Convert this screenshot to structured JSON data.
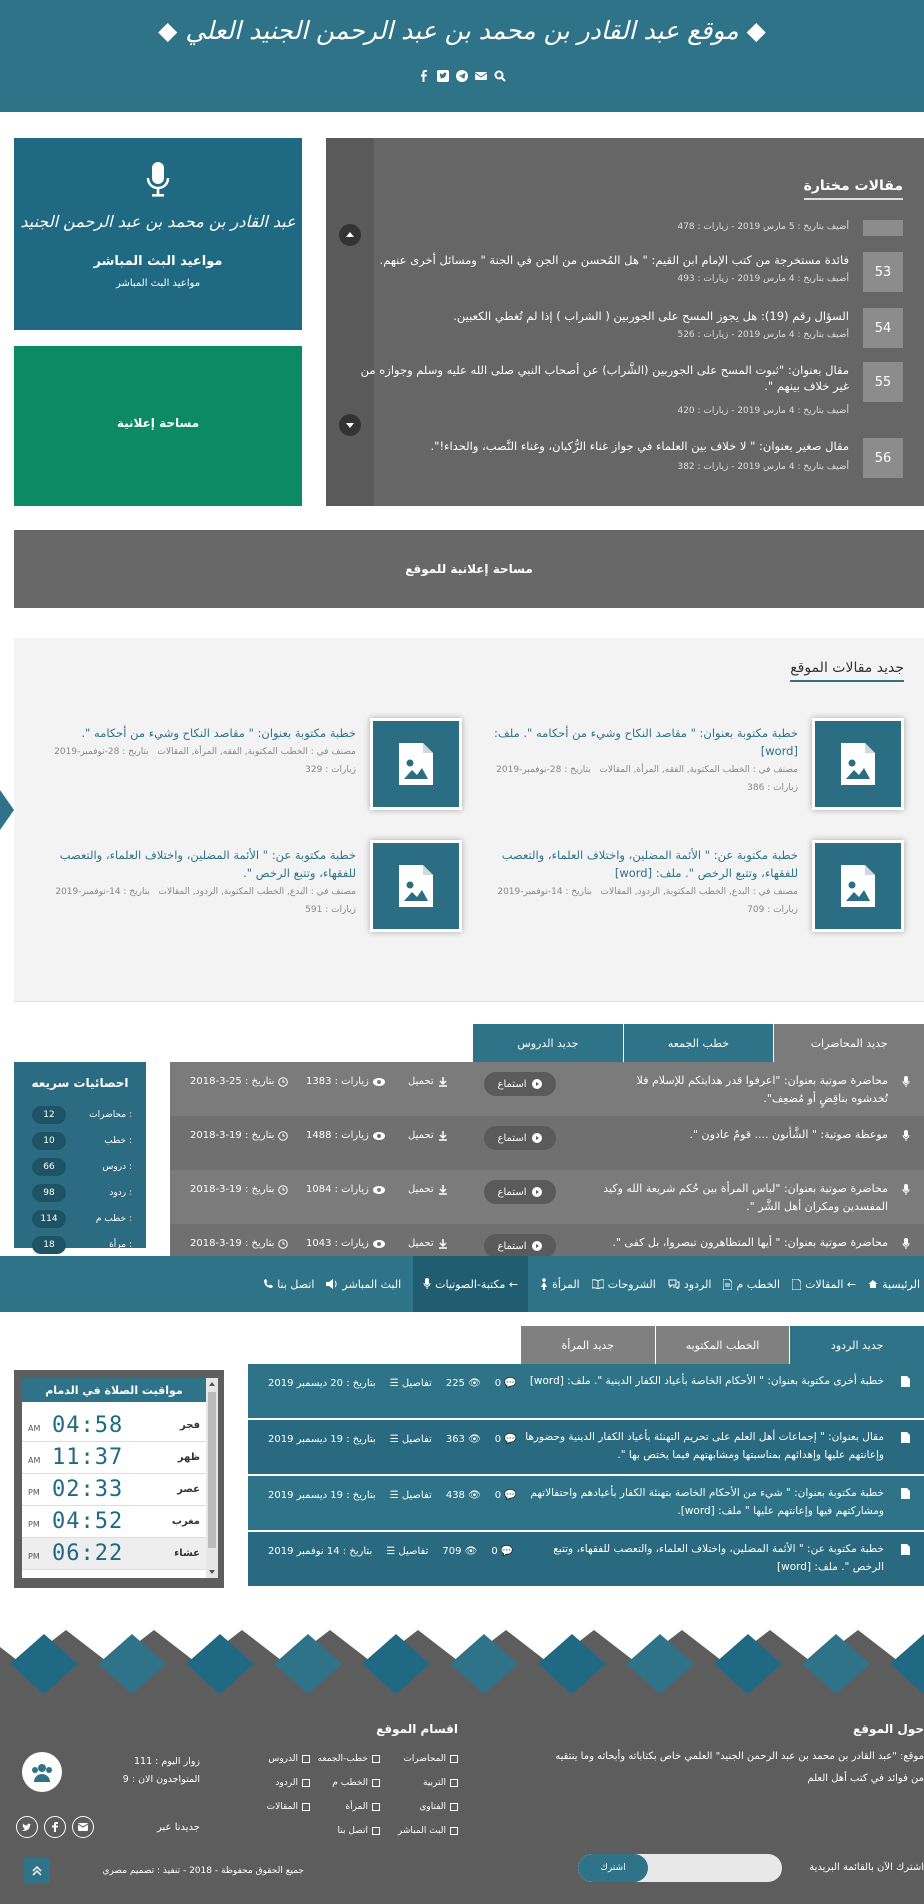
{
  "header": {
    "title": "◆ موقع عبد القادر بن محمد بن عبد الرحمن الجنيد العلي ◆"
  },
  "live_box": {
    "logo_text": "عبد القادر بن محمد بن عبد الرحمن الجنيد",
    "title": "مواعيد البث المباشر",
    "subtitle": "مواعيد البث المباشر"
  },
  "ad_box_1": {
    "label": "مساحة إعلانية"
  },
  "featured": {
    "title": "مقالات مختارة",
    "partial_meta": "أضيف بتاريخ : 5 مارس 2019 - زيارات : 478",
    "items": [
      {
        "num": "53",
        "text": "فائدة مستخرجة من كتب الإمام ابن القيم: \" هل المُحسن من الجن في الجنة \" ومسائل أخرى عنهم.",
        "meta": "أضيف بتاريخ : 4 مارس 2019 - زيارات : 493"
      },
      {
        "num": "54",
        "text": "السؤال رقم (19): هل يجوز المسح على الجوربين ( الشراب ) إذا لم تُغطي الكعبين.",
        "meta": "أضيف بتاريخ : 4 مارس 2019 - زيارات : 526"
      },
      {
        "num": "55",
        "text": "مقال بعنوان: \"ثبوت المسح على الجوربين (الشَّراب) عن أصحاب النبي صلى الله عليه وسلم وجوازه من غير خلاف بينهم \".",
        "meta": "أضيف بتاريخ : 4 مارس 2019 - زيارات : 420"
      },
      {
        "num": "56",
        "text": "مقال صغير بعنوان: \" لا خلاف بين العلماء في جواز غناء الرُّكبان، وغناء النَّصب، والحداء!\".",
        "meta": "أضيف بتاريخ : 4 مارس 2019 - زيارات : 382"
      }
    ]
  },
  "ad_box_2": {
    "label": "مساحة إعلانية للموقع"
  },
  "new_articles": {
    "title": "جديد مقالات الموقع",
    "items": [
      {
        "title": "خطبة مكتوبة بعنوان: \" مقاصد النكاح وشيء من أحكامه \". ملف: [word]",
        "category": "مصنف في : الخطب المكتوبة, الفقه, المرأة, المقالات",
        "date": "بتاريخ : 28-نوفمبر-2019",
        "visits": "زيارات : 386"
      },
      {
        "title": "خطبة مكتوبة بعنوان: \" مقاصد النكاح وشيء من أحكامه \".",
        "category": "مصنف في : الخطب المكتوبة, الفقه, المرأة, المقالات",
        "date": "بتاريخ : 28-نوفمبر-2019",
        "visits": "زيارات : 329"
      },
      {
        "title": "خطبة مكتوبة عن: \" الأئمة المضلين، واختلاف العلماء، والتعصب للفقهاء، وتتبع الرخص \". ملف: [word]",
        "category": "مصنف في : البدع, الخطب المكتوبة, الردود, المقالات",
        "date": "بتاريخ : 14-نوفمبر-2019",
        "visits": "زيارات : 709"
      },
      {
        "title": "خطبة مكتوبة عن: \" الأئمة المضلين، واختلاف العلماء، والتعصب للفقهاء، وتتبع الرخص \".",
        "category": "مصنف في : البدع, الخطب المكتوبة, الردود, المقالات",
        "date": "بتاريخ : 14-نوفمبر-2019",
        "visits": "زيارات : 591"
      }
    ]
  },
  "audio_tabs": [
    "جديد المحاضرات",
    "خطب الجمعه",
    "جديد الدروس"
  ],
  "stats": {
    "title": "احصائيات سريعه",
    "rows": [
      {
        "label": "محاضرات :",
        "value": "12"
      },
      {
        "label": "خطب :",
        "value": "10"
      },
      {
        "label": "دروس :",
        "value": "66"
      },
      {
        "label": "ردود :",
        "value": "98"
      },
      {
        "label": "خطب م :",
        "value": "114"
      },
      {
        "label": "مرأة :",
        "value": "18"
      }
    ]
  },
  "audio": {
    "listen": "استماع",
    "download": "تحميل",
    "items": [
      {
        "title": "محاضرة صوتية بعنوان: \"اعرفوا قدر هدايتكم للإسلام فلا تُخدشوه بناقِضٍ أو مُضعِف\".",
        "visits": "زيارات : 1383",
        "date": "بتاريخ : 25-3-2018"
      },
      {
        "title": "موعظة صوتية: \" الشَّأنون .... قومٌ عادون \".",
        "visits": "زيارات : 1488",
        "date": "بتاريخ : 19-3-2018"
      },
      {
        "title": "محاضرة صوتية بعنوان: \"لباس المرأة بين حُكم شريعة الله وكيد المفسدين ومكران أهل الشَّر \".",
        "visits": "زيارات : 1084",
        "date": "بتاريخ : 19-3-2018"
      },
      {
        "title": "محاضرة صوتية بعنوان: \" أيها المتظاهرون تبصروا، بل كفى \".",
        "visits": "زيارات : 1043",
        "date": "بتاريخ : 19-3-2018"
      }
    ]
  },
  "nav": {
    "items": [
      "الرئيسية",
      "المقالات ←",
      "الخطب م",
      "الردود",
      "الشروحات",
      "المرأة",
      "مكتبة-الصوتيات ←",
      "البث المباشر",
      "اتصل بنا"
    ]
  },
  "reply_tabs": [
    "جديد الردود",
    "الخطب المكتوبه",
    "جديد المرأة"
  ],
  "replies": {
    "details": "تفاصيل",
    "items": [
      {
        "text": "خطبة أخرى مكتوبة بعنوان: \" الأحكام الخاصة بأعياد الكفار الدينية \". ملف: [word]",
        "comments": "0",
        "views": "225",
        "date": "بتاريخ : 20 ديسمبر 2019"
      },
      {
        "text": "مقال بعنوان: \" إجماعات أهل العلم على تحريم التهنئة بأعياد الكفار الدينية وحضورها وإعانتهم عليها وإهدائهم بمناسبتها ومشابهتهم فيما يختص بها \".",
        "comments": "0",
        "views": "363",
        "date": "بتاريخ : 19 ديسمبر 2019"
      },
      {
        "text": "خطبة مكتوبة بعنوان: \" شيء من الأحكام الخاصة بتهنئة الكفار بأعيادهم واحتفالاتهم ومشاركتهم فيها وإعانتهم عليها \" ملف: [word].",
        "comments": "0",
        "views": "438",
        "date": "بتاريخ : 19 ديسمبر 2019"
      },
      {
        "text": "خطبة مكتوبة عن: \" الأئمة المضلين، واختلاف العلماء، والتعصب للفقهاء، وتتبع الرخص \". ملف: [word]",
        "comments": "0",
        "views": "709",
        "date": "بتاريخ : 14 نوفمبر 2019"
      }
    ]
  },
  "prayer": {
    "title": "مواقيت الصلاة في الدمام",
    "rows": [
      {
        "name": "فجر",
        "time": "04:58",
        "ampm": "AM"
      },
      {
        "name": "ظهر",
        "time": "11:37",
        "ampm": "AM"
      },
      {
        "name": "عصر",
        "time": "02:33",
        "ampm": "PM"
      },
      {
        "name": "مغرب",
        "time": "04:52",
        "ampm": "PM"
      },
      {
        "name": "عشاء",
        "time": "06:22",
        "ampm": "PM"
      }
    ]
  },
  "footer": {
    "about_title": "حول الموقع",
    "about_text": "موقع: \"عبد القادر بن محمد بن عبد الرحمن الجنيد\" العلمي خاص بكتاباته وأبحاثه وما ينتقيه من فوائد في كتب أهل العلم",
    "sections_title": "اقسام الموقع",
    "categories": [
      "المحاضرات",
      "خطب-الجمعه",
      "الدروس",
      "التربية",
      "الخطب م",
      "الردود",
      "الفتاوى",
      "المرأة",
      "المقالات",
      "البث المباشر",
      "اتصل بنا"
    ],
    "visitors_today": "زوار اليوم : 111",
    "online_now": "المتواجدون الان : 9",
    "follow": "جديدنا عبر",
    "newsletter": "اشترك الآن بالقائمة البريدية",
    "subscribe": "اشترك",
    "copyright": "جميع الحقوق محفوظة - 2018 - تنفيذ : تصميم مصري"
  }
}
